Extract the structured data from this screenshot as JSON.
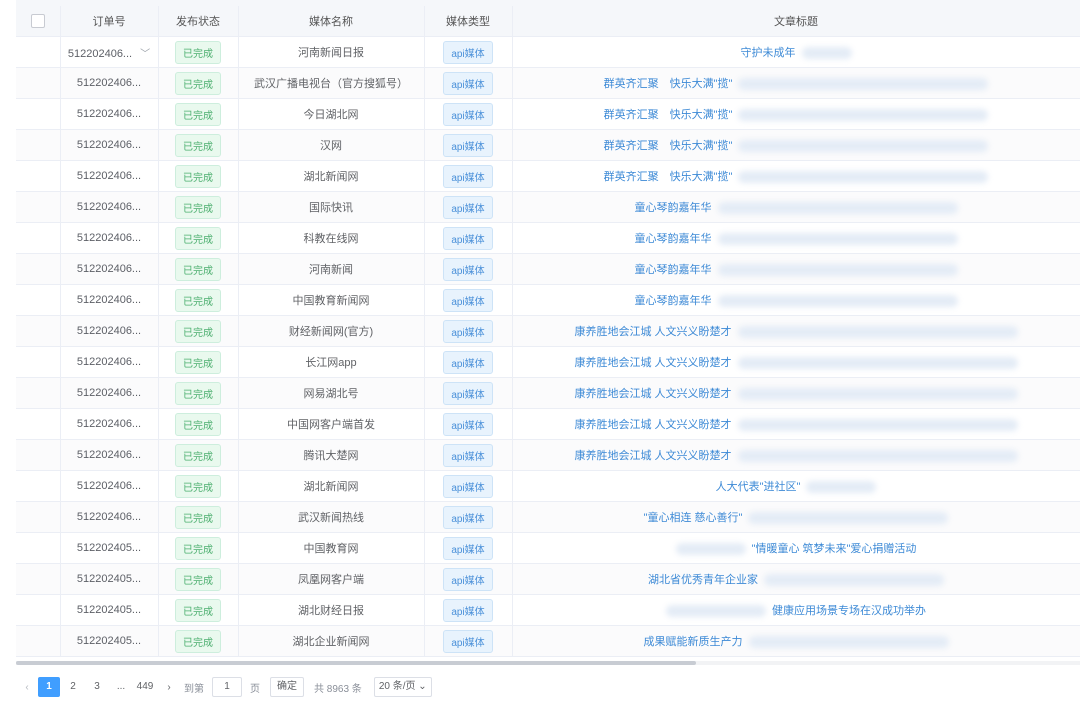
{
  "table": {
    "columns": [
      "订单号",
      "发布状态",
      "媒体名称",
      "媒体类型",
      "文章标题"
    ],
    "rows": [
      {
        "order": "512202406...",
        "status": "已完成",
        "media": "河南新闻日报",
        "type": "api媒体",
        "title": "守护未成年",
        "title_align": "center",
        "blur_before": 0,
        "blur_after": 50
      },
      {
        "order": "512202406...",
        "status": "已完成",
        "media": "武汉广播电视台（官方搜狐号）",
        "type": "api媒体",
        "title": "群英齐汇聚　快乐大满\"揽\"",
        "title_align": "center",
        "blur_before": 0,
        "blur_after": 250
      },
      {
        "order": "512202406...",
        "status": "已完成",
        "media": "今日湖北网",
        "type": "api媒体",
        "title": "群英齐汇聚　快乐大满\"揽\"",
        "title_align": "center",
        "blur_before": 0,
        "blur_after": 250
      },
      {
        "order": "512202406...",
        "status": "已完成",
        "media": "汉网",
        "type": "api媒体",
        "title": "群英齐汇聚　快乐大满\"揽\"",
        "title_align": "center",
        "blur_before": 0,
        "blur_after": 250
      },
      {
        "order": "512202406...",
        "status": "已完成",
        "media": "湖北新闻网",
        "type": "api媒体",
        "title": "群英齐汇聚　快乐大满\"揽\"",
        "title_align": "center",
        "blur_before": 0,
        "blur_after": 250
      },
      {
        "order": "512202406...",
        "status": "已完成",
        "media": "国际快讯",
        "type": "api媒体",
        "title": "童心琴韵嘉年华",
        "title_align": "center",
        "blur_before": 0,
        "blur_after": 240
      },
      {
        "order": "512202406...",
        "status": "已完成",
        "media": "科教在线网",
        "type": "api媒体",
        "title": "童心琴韵嘉年华",
        "title_align": "center",
        "blur_before": 0,
        "blur_after": 240
      },
      {
        "order": "512202406...",
        "status": "已完成",
        "media": "河南新闻",
        "type": "api媒体",
        "title": "童心琴韵嘉年华",
        "title_align": "center",
        "blur_before": 0,
        "blur_after": 240
      },
      {
        "order": "512202406...",
        "status": "已完成",
        "media": "中国教育新闻网",
        "type": "api媒体",
        "title": "童心琴韵嘉年华",
        "title_align": "center",
        "blur_before": 0,
        "blur_after": 240
      },
      {
        "order": "512202406...",
        "status": "已完成",
        "media": "财经新闻网(官方)",
        "type": "api媒体",
        "title": "康养胜地会江城 人文兴义盼楚才",
        "title_align": "center",
        "blur_before": 0,
        "blur_after": 280
      },
      {
        "order": "512202406...",
        "status": "已完成",
        "media": "长江网app",
        "type": "api媒体",
        "title": "康养胜地会江城 人文兴义盼楚才",
        "title_align": "center",
        "blur_before": 0,
        "blur_after": 280
      },
      {
        "order": "512202406...",
        "status": "已完成",
        "media": "网易湖北号",
        "type": "api媒体",
        "title": "康养胜地会江城 人文兴义盼楚才",
        "title_align": "center",
        "blur_before": 0,
        "blur_after": 280
      },
      {
        "order": "512202406...",
        "status": "已完成",
        "media": "中国网客户端首发",
        "type": "api媒体",
        "title": "康养胜地会江城 人文兴义盼楚才",
        "title_align": "center",
        "blur_before": 0,
        "blur_after": 280
      },
      {
        "order": "512202406...",
        "status": "已完成",
        "media": "腾讯大楚网",
        "type": "api媒体",
        "title": "康养胜地会江城 人文兴义盼楚才",
        "title_align": "center",
        "blur_before": 0,
        "blur_after": 280
      },
      {
        "order": "512202406...",
        "status": "已完成",
        "media": "湖北新闻网",
        "type": "api媒体",
        "title": "人大代表\"进社区\"",
        "title_align": "center",
        "blur_before": 0,
        "blur_after": 70
      },
      {
        "order": "512202406...",
        "status": "已完成",
        "media": "武汉新闻热线",
        "type": "api媒体",
        "title": "\"童心相连 慈心善行\"",
        "title_align": "center",
        "blur_before": 0,
        "blur_after": 200
      },
      {
        "order": "512202405...",
        "status": "已完成",
        "media": "中国教育网",
        "type": "api媒体",
        "title": "\"情暖童心 筑梦未来\"爱心捐赠活动",
        "title_align": "center",
        "blur_before": 70,
        "blur_after": 0
      },
      {
        "order": "512202405...",
        "status": "已完成",
        "media": "凤凰网客户端",
        "type": "api媒体",
        "title": "湖北省优秀青年企业家",
        "title_align": "center",
        "blur_before": 0,
        "blur_after": 180
      },
      {
        "order": "512202405...",
        "status": "已完成",
        "media": "湖北财经日报",
        "type": "api媒体",
        "title": "健康应用场景专场在汉成功举办",
        "title_align": "center",
        "blur_before": 100,
        "blur_after": 0
      },
      {
        "order": "512202405...",
        "status": "已完成",
        "media": "湖北企业新闻网",
        "type": "api媒体",
        "title": "成果赋能新质生产力",
        "title_align": "center",
        "blur_before": 0,
        "blur_after": 200
      }
    ]
  },
  "pagination": {
    "pages": [
      "1",
      "2",
      "3",
      "...",
      "449"
    ],
    "current": "1",
    "goto_label": "到第",
    "goto_value": "1",
    "page_suffix": "页",
    "confirm_label": "确定",
    "total_text": "共 8963 条",
    "page_size": "20 条/页",
    "icons": {
      "prev": "chevron-left-icon",
      "next": "chevron-right-icon",
      "size": "chevron-down-icon"
    }
  }
}
